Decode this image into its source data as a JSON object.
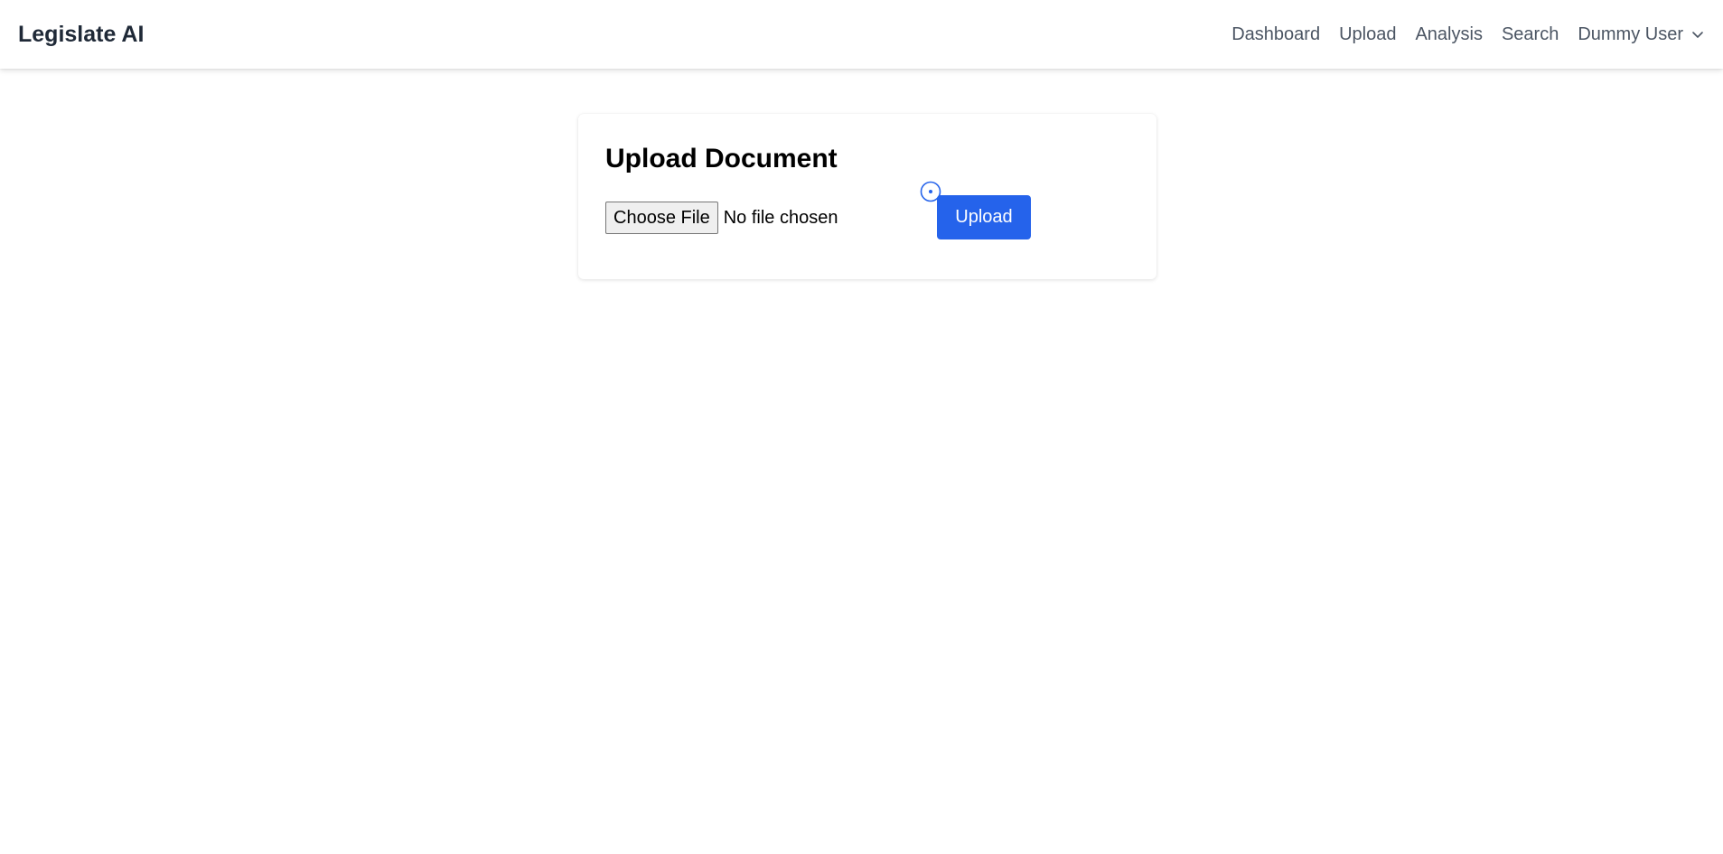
{
  "navbar": {
    "brand": "Legislate AI",
    "links": [
      {
        "label": "Dashboard"
      },
      {
        "label": "Upload"
      },
      {
        "label": "Analysis"
      },
      {
        "label": "Search"
      }
    ],
    "user": {
      "name": "Dummy User",
      "icon": "chevron-down-icon"
    }
  },
  "upload_card": {
    "title": "Upload Document",
    "choose_file_label": "Choose File",
    "file_status": "No file chosen",
    "upload_label": "Upload"
  },
  "colors": {
    "accent": "#2563eb",
    "nav_text": "#4b5563",
    "brand_text": "#1f2937"
  }
}
